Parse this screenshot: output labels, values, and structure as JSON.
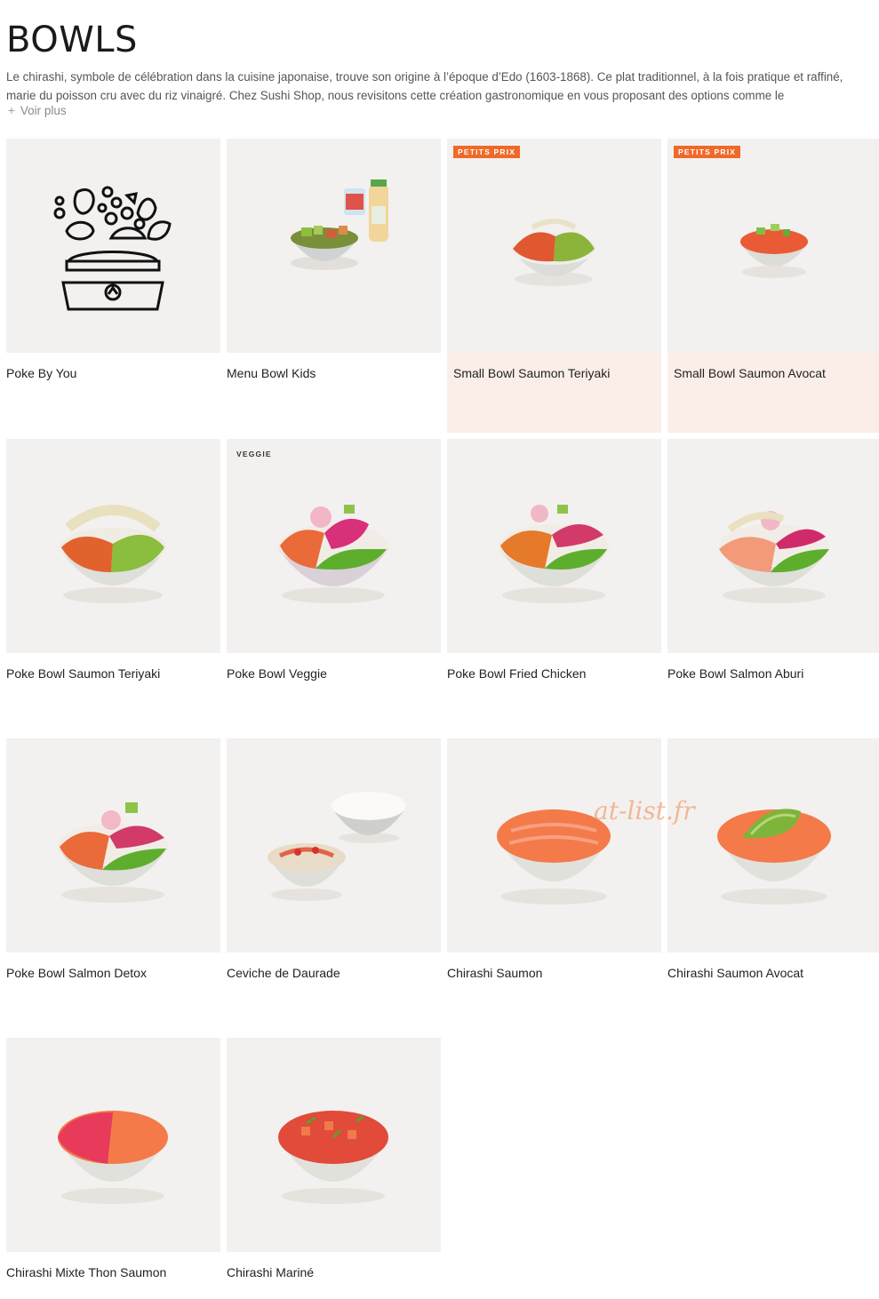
{
  "header": {
    "title": "BOWLS",
    "intro": "Le chirashi, symbole de célébration dans la cuisine japonaise, trouve son origine à l’époque d’Edo (1603-1868). Ce plat traditionnel, à la fois pratique et raffiné, marie du poisson cru avec du riz vinaigré. Chez Sushi Shop, nous revisitons cette création gastronomique en vous proposant des options comme le",
    "more_label": "Voir plus"
  },
  "watermark": "at-list.fr",
  "products": [
    {
      "name": "Poke By You",
      "badge": "",
      "icon": "poke-builder-icon"
    },
    {
      "name": "Menu Bowl Kids",
      "badge": "",
      "icon": "kids-menu-image"
    },
    {
      "name": "Small Bowl Saumon Teriyaki",
      "badge": "PETITS PRIX",
      "icon": "bowl-image"
    },
    {
      "name": "Small Bowl Saumon Avocat",
      "badge": "PETITS PRIX",
      "icon": "bowl-image"
    },
    {
      "name": "Poke Bowl Saumon Teriyaki",
      "badge": "",
      "icon": "bowl-image"
    },
    {
      "name": "Poke Bowl Veggie",
      "badge": "VEGGIE",
      "icon": "bowl-image"
    },
    {
      "name": "Poke Bowl Fried Chicken",
      "badge": "",
      "icon": "bowl-image"
    },
    {
      "name": "Poke Bowl Salmon Aburi",
      "badge": "",
      "icon": "bowl-image"
    },
    {
      "name": "Poke Bowl Salmon Detox",
      "badge": "",
      "icon": "bowl-image"
    },
    {
      "name": "Ceviche de Daurade",
      "badge": "",
      "icon": "bowl-image"
    },
    {
      "name": "Chirashi Saumon",
      "badge": "",
      "icon": "bowl-image"
    },
    {
      "name": "Chirashi Saumon Avocat",
      "badge": "",
      "icon": "bowl-image"
    },
    {
      "name": "Chirashi Mixte Thon Saumon",
      "badge": "",
      "icon": "bowl-image"
    },
    {
      "name": "Chirashi Mariné",
      "badge": "",
      "icon": "bowl-image"
    }
  ],
  "colors": {
    "promo_badge": "#ef6a2a",
    "promo_card": "#fbeee9",
    "tile_background": "#f3f1ef"
  }
}
